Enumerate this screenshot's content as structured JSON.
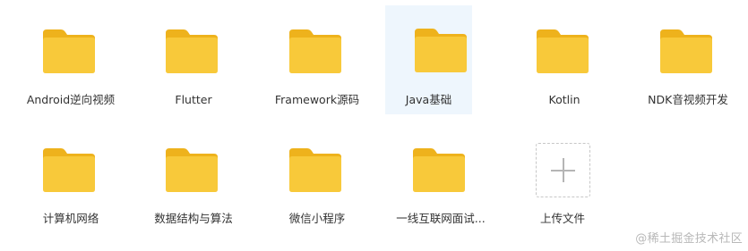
{
  "folders": [
    {
      "label": "Android逆向视频",
      "icon": "folder-icon",
      "selected": false
    },
    {
      "label": "Flutter",
      "icon": "folder-icon",
      "selected": false
    },
    {
      "label": "Framework源码",
      "icon": "folder-icon",
      "selected": false
    },
    {
      "label": "Java基础",
      "icon": "folder-icon",
      "selected": true
    },
    {
      "label": "Kotlin",
      "icon": "folder-icon",
      "selected": false
    },
    {
      "label": "NDK音视频开发",
      "icon": "folder-icon",
      "selected": false
    },
    {
      "label": "计算机网络",
      "icon": "folder-icon",
      "selected": false
    },
    {
      "label": "数据结构与算法",
      "icon": "folder-icon",
      "selected": false
    },
    {
      "label": "微信小程序",
      "icon": "folder-icon",
      "selected": false
    },
    {
      "label": "一线互联网面试...",
      "icon": "folder-icon",
      "selected": false
    }
  ],
  "upload": {
    "label": "上传文件",
    "icon": "plus-icon"
  },
  "watermark": "@稀土掘金技术社区",
  "colors": {
    "folder_body": "#f8c93a",
    "folder_tab": "#eeb21c",
    "folder_front": "#fad04b",
    "selected_bg": "#eef6fd",
    "text": "#333333"
  }
}
